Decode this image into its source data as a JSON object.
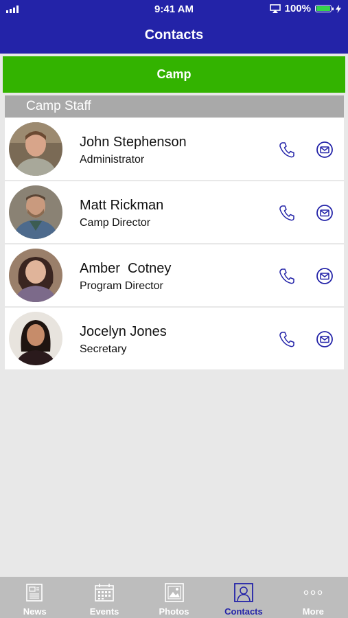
{
  "status_bar": {
    "time": "9:41 AM",
    "battery": "100%"
  },
  "header": {
    "title": "Contacts"
  },
  "group": {
    "label": "Camp"
  },
  "section": {
    "label": "Camp Staff"
  },
  "contacts": [
    {
      "name": "John Stephenson",
      "role": "Administrator"
    },
    {
      "name": "Matt Rickman",
      "role": "Camp Director"
    },
    {
      "name": "Amber  Cotney",
      "role": "Program Director"
    },
    {
      "name": "Jocelyn Jones",
      "role": "Secretary"
    }
  ],
  "tabs": [
    {
      "label": "News",
      "icon": "newspaper-icon"
    },
    {
      "label": "Events",
      "icon": "calendar-icon"
    },
    {
      "label": "Photos",
      "icon": "photo-icon"
    },
    {
      "label": "Contacts",
      "icon": "contact-icon",
      "active": true
    },
    {
      "label": "More",
      "icon": "more-icon"
    }
  ],
  "colors": {
    "header": "#2323a8",
    "group_bar": "#33b300",
    "section": "#a9a9a9",
    "tabbar": "#bdbdbd"
  }
}
